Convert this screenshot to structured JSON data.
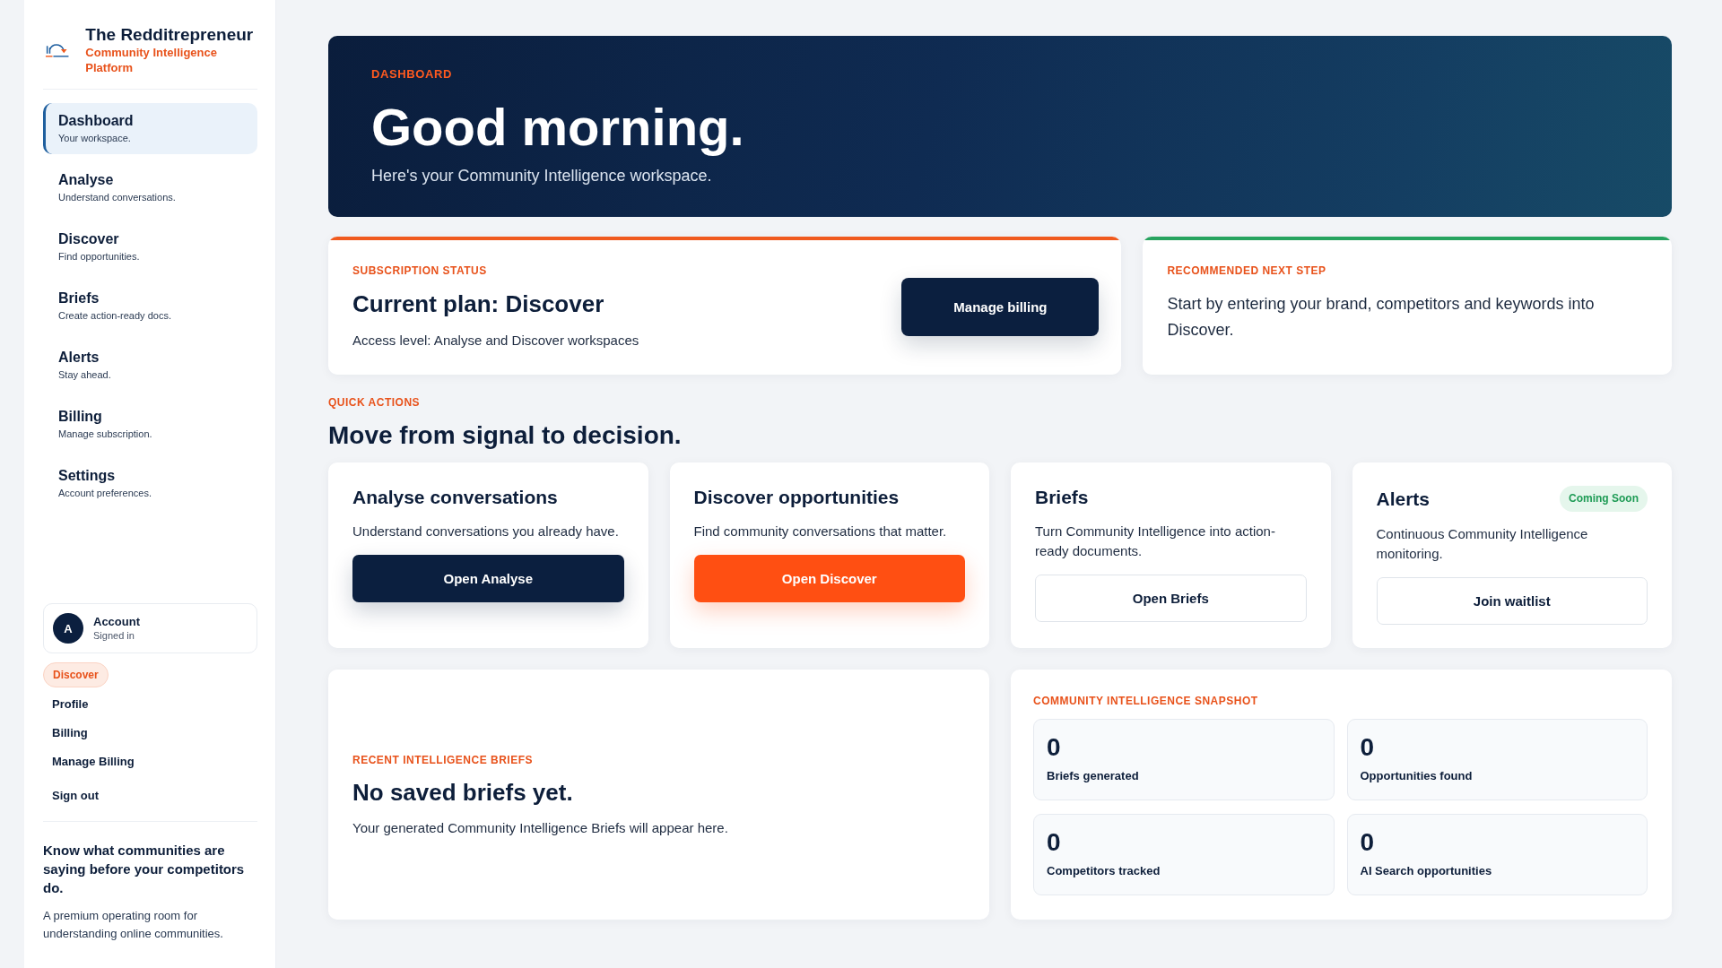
{
  "sidebar": {
    "brand": {
      "title": "The Redditrepreneur",
      "subtitle": "Community Intelligence Platform"
    },
    "nav": [
      {
        "label": "Dashboard",
        "hint": "Your workspace.",
        "selected": true
      },
      {
        "label": "Analyse",
        "hint": "Understand conversations.",
        "selected": false
      },
      {
        "label": "Discover",
        "hint": "Find opportunities.",
        "selected": false
      },
      {
        "label": "Briefs",
        "hint": "Create action-ready docs.",
        "selected": false
      },
      {
        "label": "Alerts",
        "hint": "Stay ahead.",
        "selected": false
      },
      {
        "label": "Billing",
        "hint": "Manage subscription.",
        "selected": false
      },
      {
        "label": "Settings",
        "hint": "Account preferences.",
        "selected": false
      }
    ],
    "account": {
      "initial": "A",
      "name": "Account",
      "status": "Signed in",
      "plan": "Discover",
      "links": [
        "Profile",
        "Billing",
        "Manage Billing",
        "Sign out"
      ]
    },
    "tagline": "Know what communities are saying before your competitors do.",
    "blurb": "A premium operating room for understanding online communities."
  },
  "hero": {
    "eyebrow": "DASHBOARD",
    "title": "Good morning.",
    "subtitle": "Here's your Community Intelligence workspace."
  },
  "status_cards": [
    {
      "kind": "plan",
      "color": "#f05a1e",
      "eyebrow": "SUBSCRIPTION STATUS",
      "title": "Current plan: Discover",
      "text": "Access level: Analyse and Discover workspaces",
      "button": "Manage billing"
    },
    {
      "kind": "note",
      "color": "#27a35f",
      "eyebrow": "RECOMMENDED NEXT STEP",
      "text": "Start by entering your brand, competitors and keywords into Discover."
    }
  ],
  "quick_actions": {
    "eyebrow": "QUICK ACTIONS",
    "title": "Move from signal to decision.",
    "cards": [
      {
        "title": "Analyse conversations",
        "text": "Understand conversations you already have.",
        "button": {
          "kind": "dark",
          "label": "Open Analyse"
        }
      },
      {
        "title": "Discover opportunities",
        "text": "Find community conversations that matter.",
        "button": {
          "kind": "accent",
          "label": "Open Discover"
        }
      },
      {
        "title": "Briefs",
        "text": "Turn Community Intelligence into action-ready documents.",
        "button": {
          "kind": "outline",
          "label": "Open Briefs"
        }
      },
      {
        "title": "Alerts",
        "badge": "Coming Soon",
        "text": "Continuous Community Intelligence monitoring.",
        "button": {
          "kind": "outline",
          "label": "Join waitlist"
        }
      }
    ]
  },
  "recent_briefs": {
    "eyebrow": "RECENT INTELLIGENCE BRIEFS",
    "title": "No saved briefs yet.",
    "text": "Your generated Community Intelligence Briefs will appear here."
  },
  "snapshot": {
    "eyebrow": "COMMUNITY INTELLIGENCE SNAPSHOT",
    "stats": [
      {
        "value": "0",
        "label": "Briefs generated"
      },
      {
        "value": "0",
        "label": "Opportunities found"
      },
      {
        "value": "0",
        "label": "Competitors tracked"
      },
      {
        "value": "0",
        "label": "AI Search opportunities"
      }
    ]
  }
}
